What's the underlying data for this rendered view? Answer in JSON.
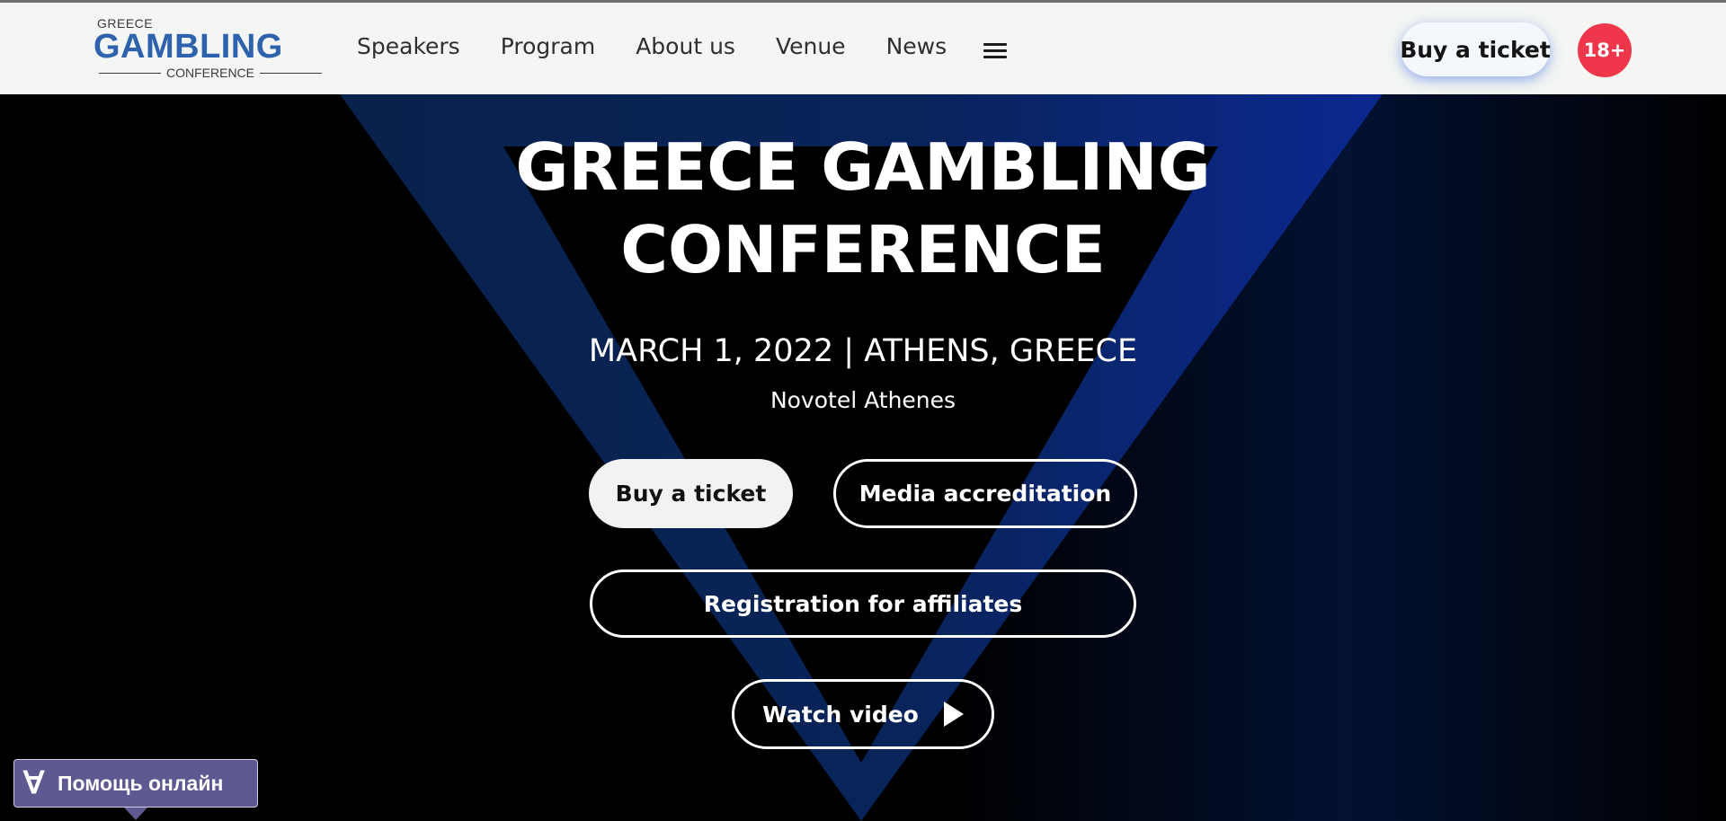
{
  "logo": {
    "top": "GREECE",
    "main": "GAMBLING",
    "sub": "CONFERENCE"
  },
  "nav": {
    "items": [
      "Speakers",
      "Program",
      "About us",
      "Venue",
      "News"
    ],
    "menu_icon": "hamburger-icon"
  },
  "header": {
    "ticket_label": "Buy a ticket",
    "age_badge": "18+"
  },
  "hero": {
    "title_line1": "GREECE GAMBLING",
    "title_line2": "CONFERENCE",
    "date": "MARCH 1, 2022 | ATHENS, GREECE",
    "venue": "Novotel Athenes",
    "buy_ticket": "Buy a ticket",
    "media_accreditation": "Media accreditation",
    "affiliates": "Registration for affiliates",
    "watch_video": "Watch video"
  },
  "help_widget": {
    "icon": "∀",
    "label": "Помощь онлайн"
  },
  "colors": {
    "brand_blue": "#2f62ad",
    "badge_red": "#f0364a",
    "help_purple": "#5e5a91"
  }
}
